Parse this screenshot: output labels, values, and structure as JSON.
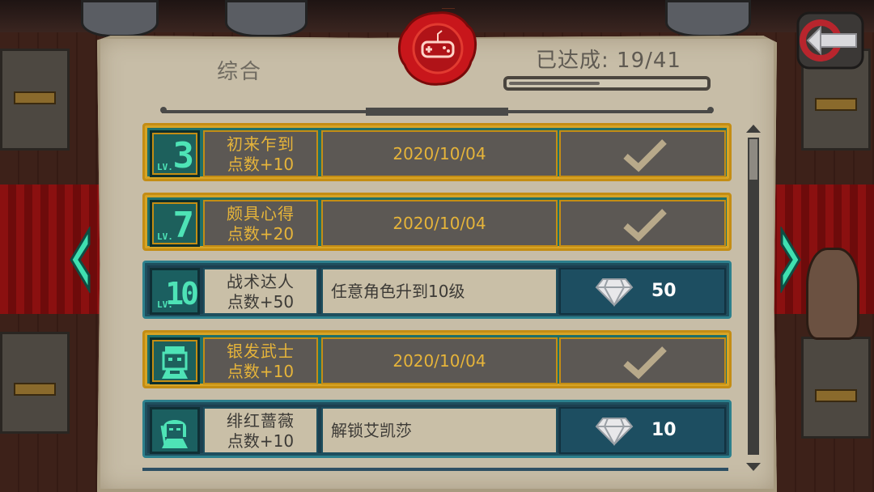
{
  "header": {
    "category_title": "综合",
    "achieved_text": "已达成: 19/41",
    "progress_fraction": 0.46
  },
  "achievements": [
    {
      "badge_num": "3",
      "badge_lv": "LV.",
      "name": "初来乍到",
      "points": "点数+10",
      "desc": "2020/10/04",
      "style": "gold",
      "reward": "check"
    },
    {
      "badge_num": "7",
      "badge_lv": "LV.",
      "name": "颇具心得",
      "points": "点数+20",
      "desc": "2020/10/04",
      "style": "gold",
      "reward": "check"
    },
    {
      "badge_num": "10",
      "badge_lv": "LV.",
      "name": "战术达人",
      "points": "点数+50",
      "desc": "任意角色升到10级",
      "style": "teal",
      "reward": "gem",
      "amount": "50"
    },
    {
      "badge_icon": "silver-samurai-portrait-icon",
      "name": "银发武士",
      "points": "点数+10",
      "desc": "2020/10/04",
      "style": "gold",
      "reward": "check"
    },
    {
      "badge_icon": "crimson-rose-portrait-icon",
      "name": "绯红蔷薇",
      "points": "点数+10",
      "desc": "解锁艾凯莎",
      "style": "teal",
      "reward": "gem",
      "amount": "10"
    }
  ],
  "colors": {
    "gold_border": "#c48d14",
    "gold_text": "#e6b43a",
    "teal_badge_text": "#4ee3b6",
    "parchment": "#c7bda7",
    "seal_red": "#c8161b"
  },
  "icons": {
    "seal": "gamepad-wax-seal-icon",
    "check": "checkmark-icon",
    "gem": "diamond-icon",
    "back": "back-arrow-icon",
    "nav_left": "chevron-left-icon",
    "nav_right": "chevron-right-icon"
  }
}
